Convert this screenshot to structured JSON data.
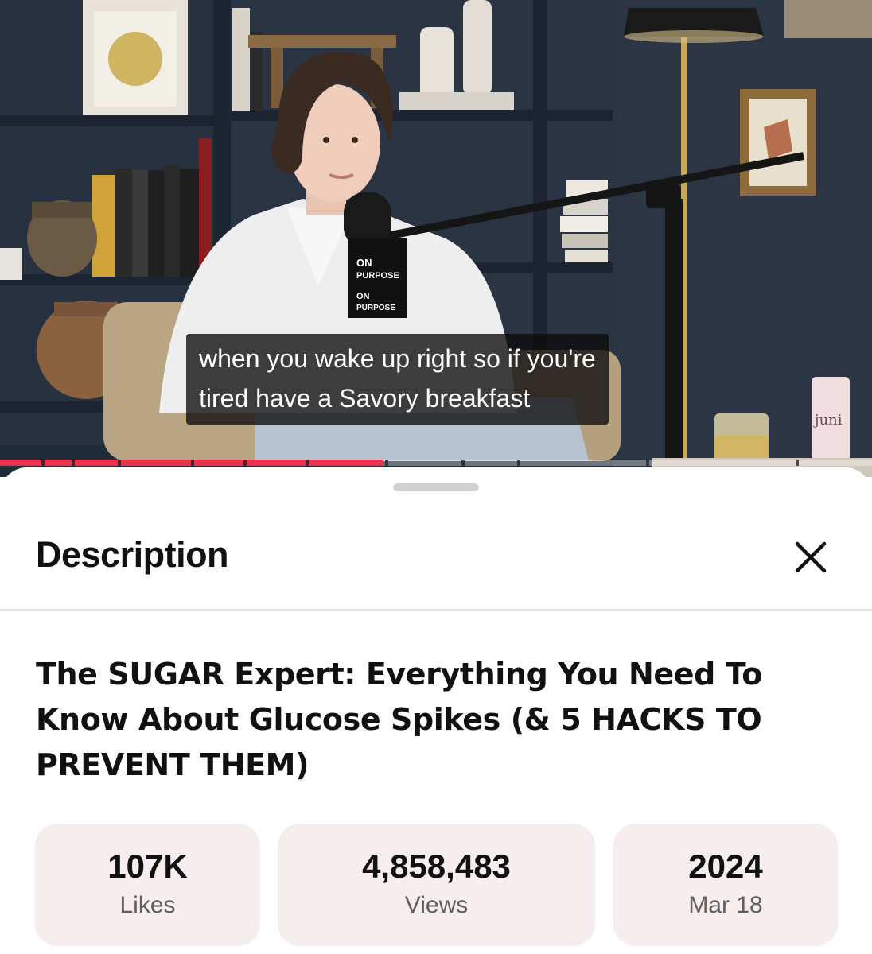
{
  "video": {
    "caption_lines": [
      "when you wake up right so if you're",
      "tired have a Savory breakfast"
    ],
    "mic_brand": "ON PURPOSE",
    "can_label": "juni",
    "progress_fraction": 0.44
  },
  "sheet": {
    "title": "Description",
    "close_icon": "close-icon"
  },
  "video_title": "The SUGAR Expert: Everything You Need To Know About Glucose Spikes (& 5 HACKS TO PREVENT THEM)",
  "stats": {
    "likes": {
      "value": "107K",
      "label": "Likes"
    },
    "views": {
      "value": "4,858,483",
      "label": "Views"
    },
    "date": {
      "value": "2024",
      "label": "Mar 18"
    }
  },
  "colors": {
    "progress_red": "#e8334a",
    "stat_bg": "#f6eeee",
    "shelf_navy": "#26303f"
  }
}
